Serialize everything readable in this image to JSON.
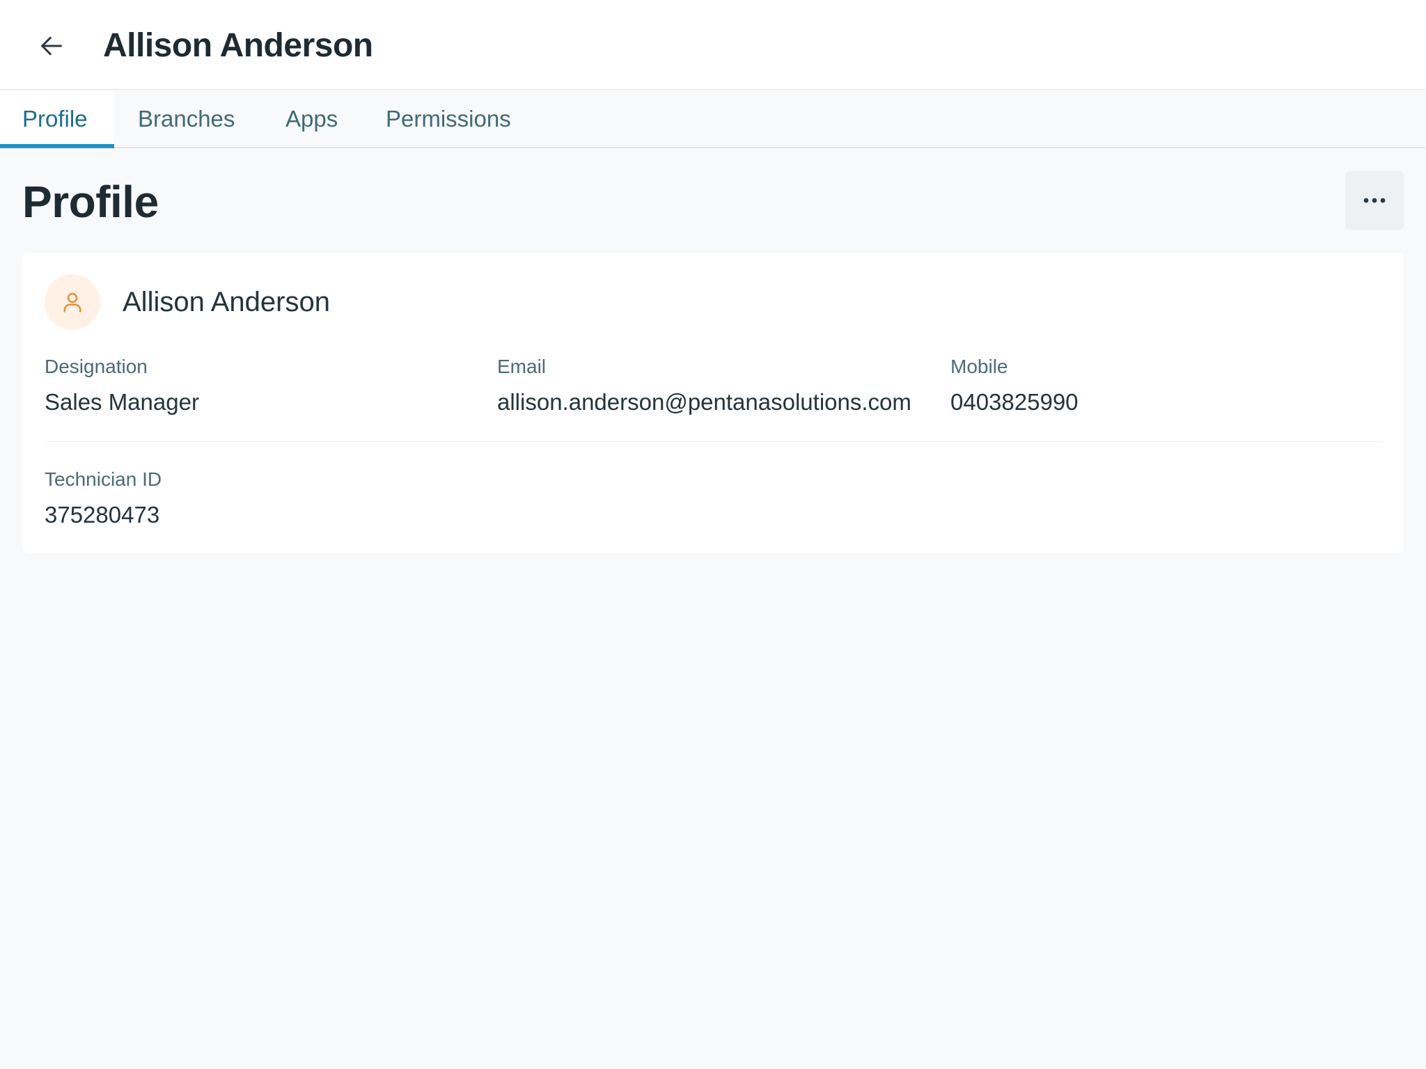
{
  "header": {
    "title": "Allison Anderson",
    "back_icon": "arrow-left-icon"
  },
  "tabs": [
    {
      "label": "Profile",
      "active": true
    },
    {
      "label": "Branches",
      "active": false
    },
    {
      "label": "Apps",
      "active": false
    },
    {
      "label": "Permissions",
      "active": false
    }
  ],
  "page": {
    "title": "Profile",
    "more_icon": "more-horizontal-icon"
  },
  "profile_card": {
    "avatar_icon": "user-icon",
    "name": "Allison Anderson",
    "fields": [
      {
        "label": "Designation",
        "value": "Sales Manager"
      },
      {
        "label": "Email",
        "value": "allison.anderson@pentanasolutions.com"
      },
      {
        "label": "Mobile",
        "value": "0403825990"
      },
      {
        "label": "Technician ID",
        "value": "375280473"
      }
    ]
  },
  "colors": {
    "accent": "#1d94c4",
    "tab_text": "#3e6b7a",
    "avatar_bg": "#fff1e6",
    "avatar_icon": "#e8913a",
    "background": "#f8f9fb"
  }
}
